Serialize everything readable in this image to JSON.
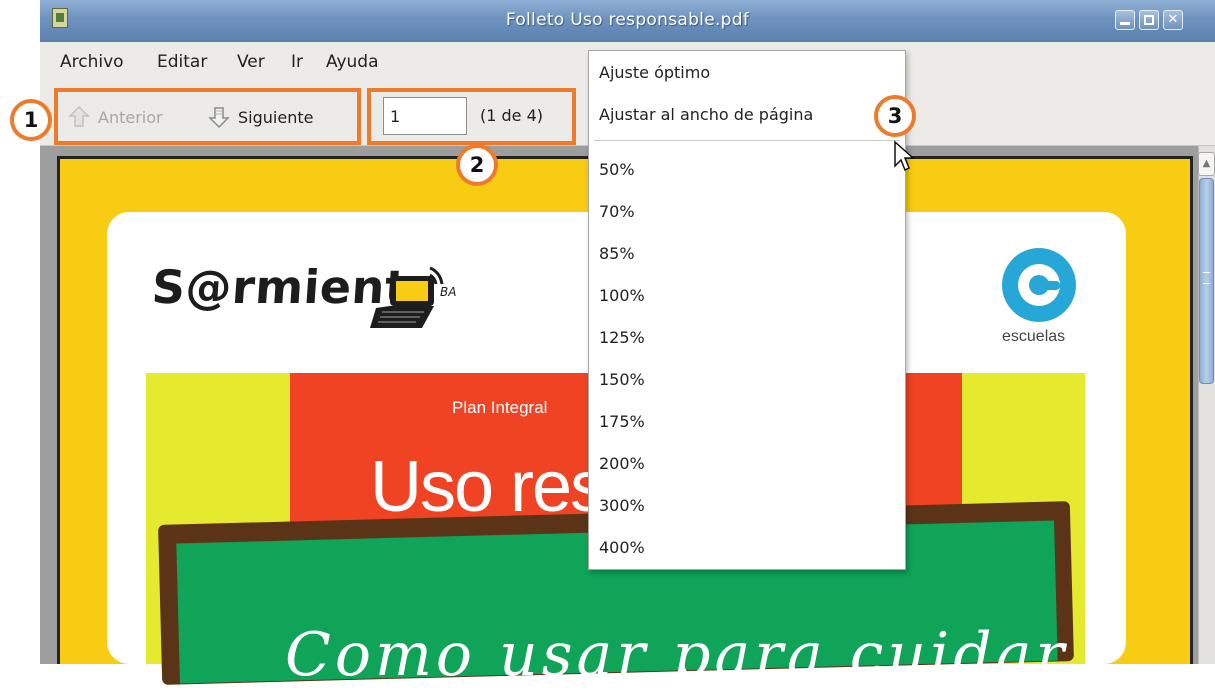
{
  "window": {
    "title": "Folleto Uso responsable.pdf"
  },
  "menubar": {
    "items": [
      {
        "label": "Archivo"
      },
      {
        "label": "Editar"
      },
      {
        "label": "Ver"
      },
      {
        "label": "Ir"
      },
      {
        "label": "Ayuda"
      }
    ]
  },
  "toolbar": {
    "prev_label": "Anterior",
    "next_label": "Siguiente",
    "page_value": "1",
    "page_count": "(1 de 4)"
  },
  "zoom_menu": {
    "items": [
      "Ajuste óptimo",
      "Ajustar al ancho de página",
      "50%",
      "70%",
      "85%",
      "100%",
      "125%",
      "150%",
      "175%",
      "200%",
      "300%",
      "400%"
    ]
  },
  "document": {
    "logo_text": "S@rmient",
    "logo_suffix": "BA",
    "escuelas_label": "escuelas",
    "plan_text": "Plan Integral",
    "headline": "Uso res",
    "board_text": "Como usar para cuidar"
  },
  "annotations": {
    "badge1": "1",
    "badge2": "2",
    "badge3": "3",
    "color": "#ee7b2c"
  },
  "icons": [
    "app-icon",
    "minimize-icon",
    "maximize-icon",
    "close-icon",
    "up-arrow-icon",
    "down-arrow-icon",
    "mouse-cursor-icon"
  ]
}
